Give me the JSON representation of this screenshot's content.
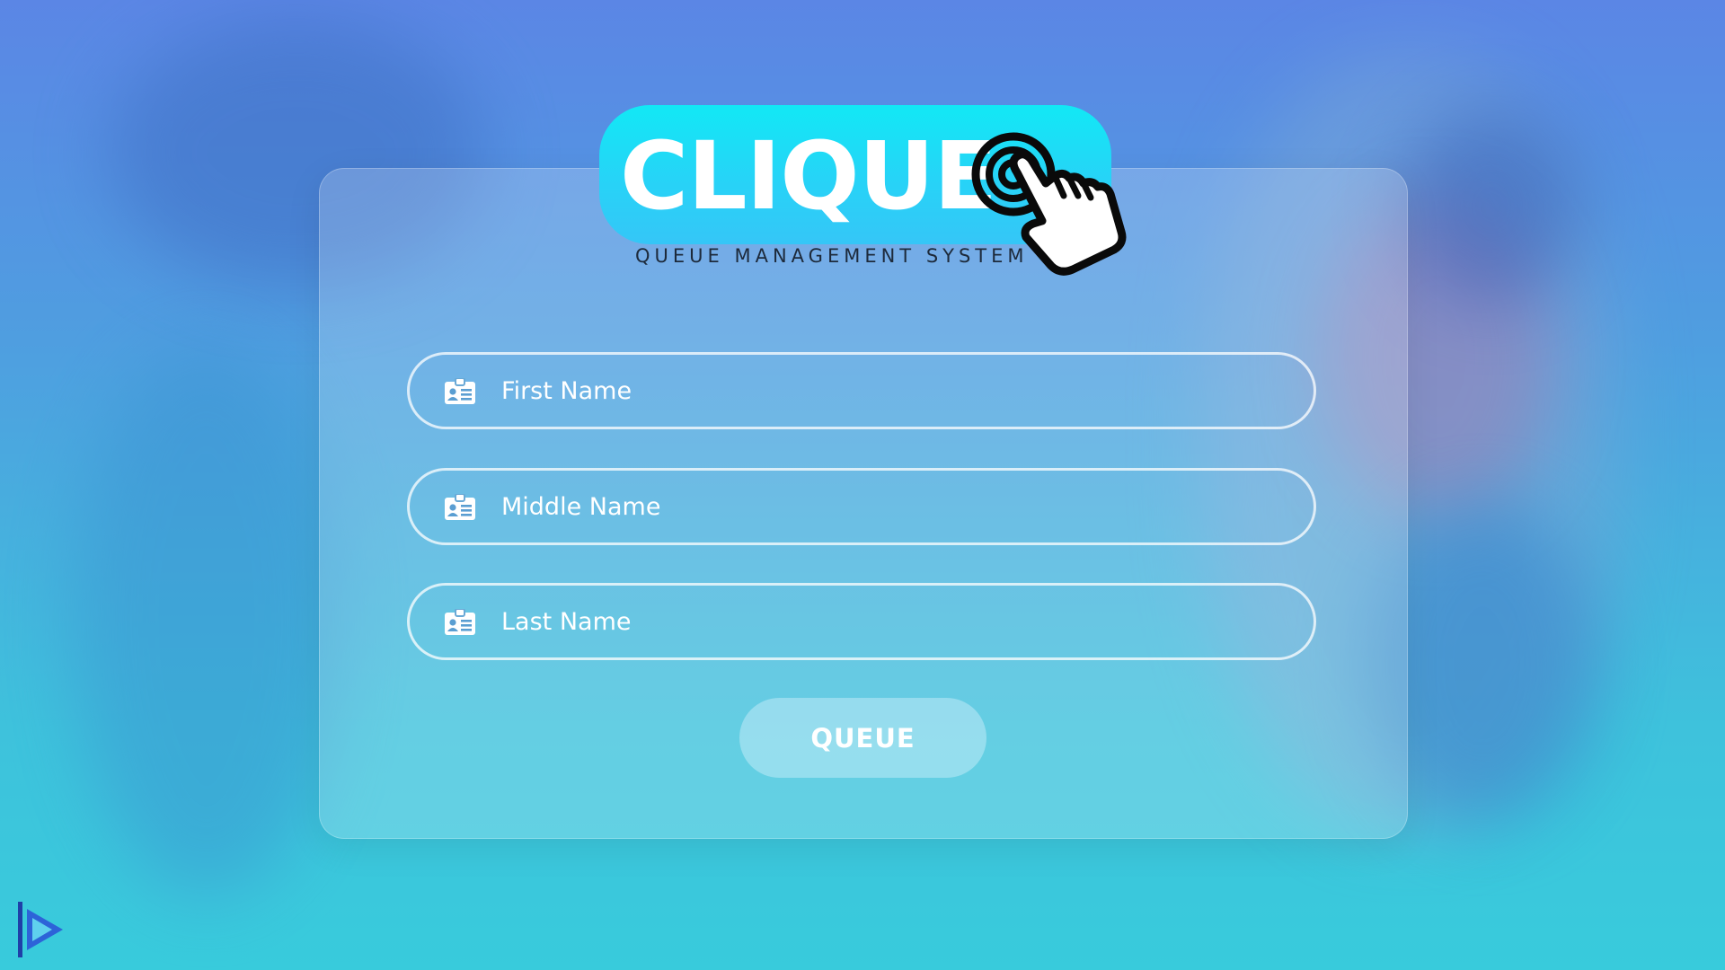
{
  "brand": {
    "logo_text": "CLIQUE",
    "subtitle": "QUEUE MANAGEMENT SYSTEM"
  },
  "form": {
    "fields": [
      {
        "placeholder": "First Name",
        "value": "",
        "icon": "id-card-icon"
      },
      {
        "placeholder": "Middle Name",
        "value": "",
        "icon": "id-card-icon"
      },
      {
        "placeholder": "Last Name",
        "value": "",
        "icon": "id-card-icon"
      }
    ],
    "submit_label": "QUEUE"
  },
  "corner": {
    "icon": "play-icon"
  },
  "colors": {
    "logo_pill_top": "#12e8f5",
    "logo_pill_bottom": "#35c6f7",
    "background_top": "#5b86e5",
    "background_bottom": "#38cbdc",
    "subtitle": "#1d2a3b",
    "input_border": "#ffffff"
  }
}
